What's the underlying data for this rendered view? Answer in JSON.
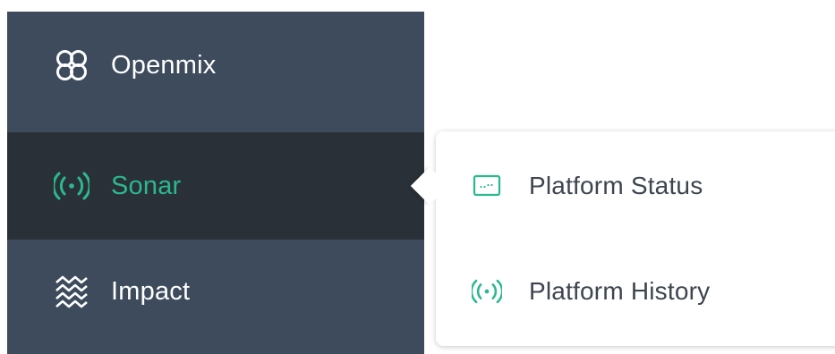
{
  "sidebar": {
    "items": [
      {
        "label": "Openmix",
        "icon": "openmix-icon",
        "active": false
      },
      {
        "label": "Sonar",
        "icon": "sonar-icon",
        "active": true
      },
      {
        "label": "Impact",
        "icon": "impact-icon",
        "active": false
      }
    ]
  },
  "popover": {
    "items": [
      {
        "label": "Platform Status",
        "icon": "platform-status-icon"
      },
      {
        "label": "Platform History",
        "icon": "platform-history-icon"
      }
    ]
  },
  "colors": {
    "sidebar_bg": "#3d4b5c",
    "active_bg": "#2a3037",
    "accent": "#2bb88f",
    "popover_text": "#3d4550"
  }
}
